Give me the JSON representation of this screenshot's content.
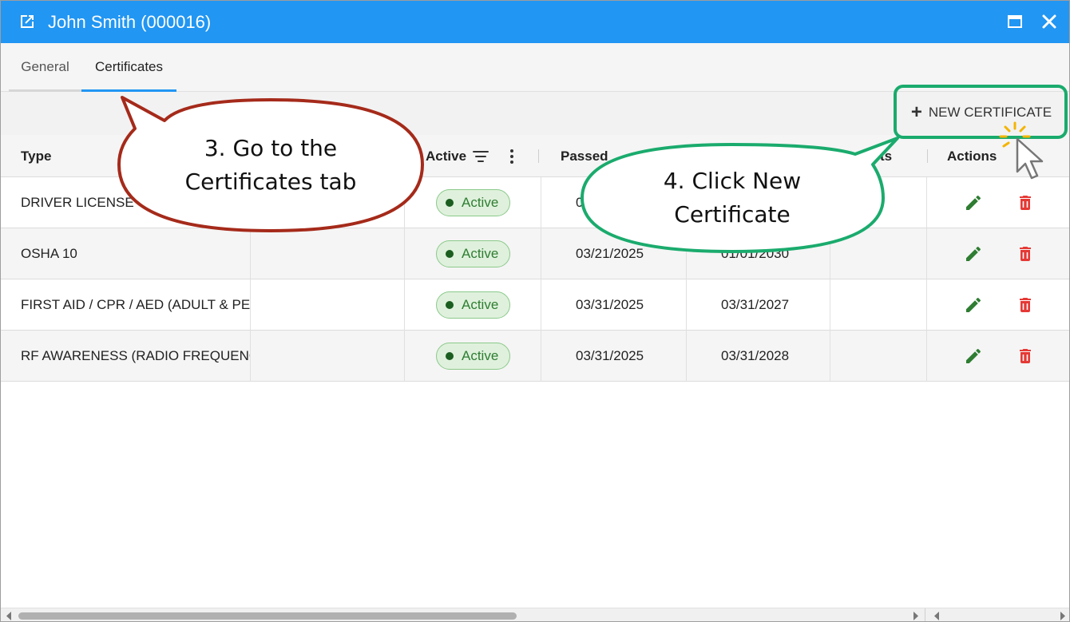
{
  "window": {
    "title": "John Smith (000016)",
    "accent_color": "#2196f3",
    "icons": {
      "title": "open-external-icon",
      "maximize": "maximize-icon",
      "close": "close-icon"
    }
  },
  "tabs": [
    {
      "label": "General",
      "active": false
    },
    {
      "label": "Certificates",
      "active": true
    }
  ],
  "toolbar": {
    "new_certificate_label": "NEW CERTIFICATE",
    "new_certificate_icon": "plus-icon"
  },
  "grid": {
    "columns": {
      "type": "Type",
      "active": "Active",
      "passed": "Passed",
      "comments_suffix": "ts",
      "actions": "Actions"
    },
    "rows": [
      {
        "type": "DRIVER LICENSE",
        "status": "Active",
        "passed": "0",
        "expires": ""
      },
      {
        "type": "OSHA 10",
        "status": "Active",
        "passed": "03/21/2025",
        "expires": "01/01/2030"
      },
      {
        "type": "FIRST AID / CPR / AED (ADULT & PEDIATRIC)",
        "status": "Active",
        "passed": "03/31/2025",
        "expires": "03/31/2027"
      },
      {
        "type": "RF AWARENESS (RADIO FREQUENCY)",
        "status": "Active",
        "passed": "03/31/2025",
        "expires": "03/31/2028"
      }
    ],
    "status_color": "#2e7d32",
    "edit_color": "#2e7d32",
    "delete_color": "#e53935"
  },
  "callouts": {
    "step3": {
      "line1": "3. Go to the",
      "line2": "Certificates tab",
      "color": "#a52a1a"
    },
    "step4": {
      "line1": "4. Click New",
      "line2": "Certificate",
      "color": "#1aab6d"
    }
  }
}
